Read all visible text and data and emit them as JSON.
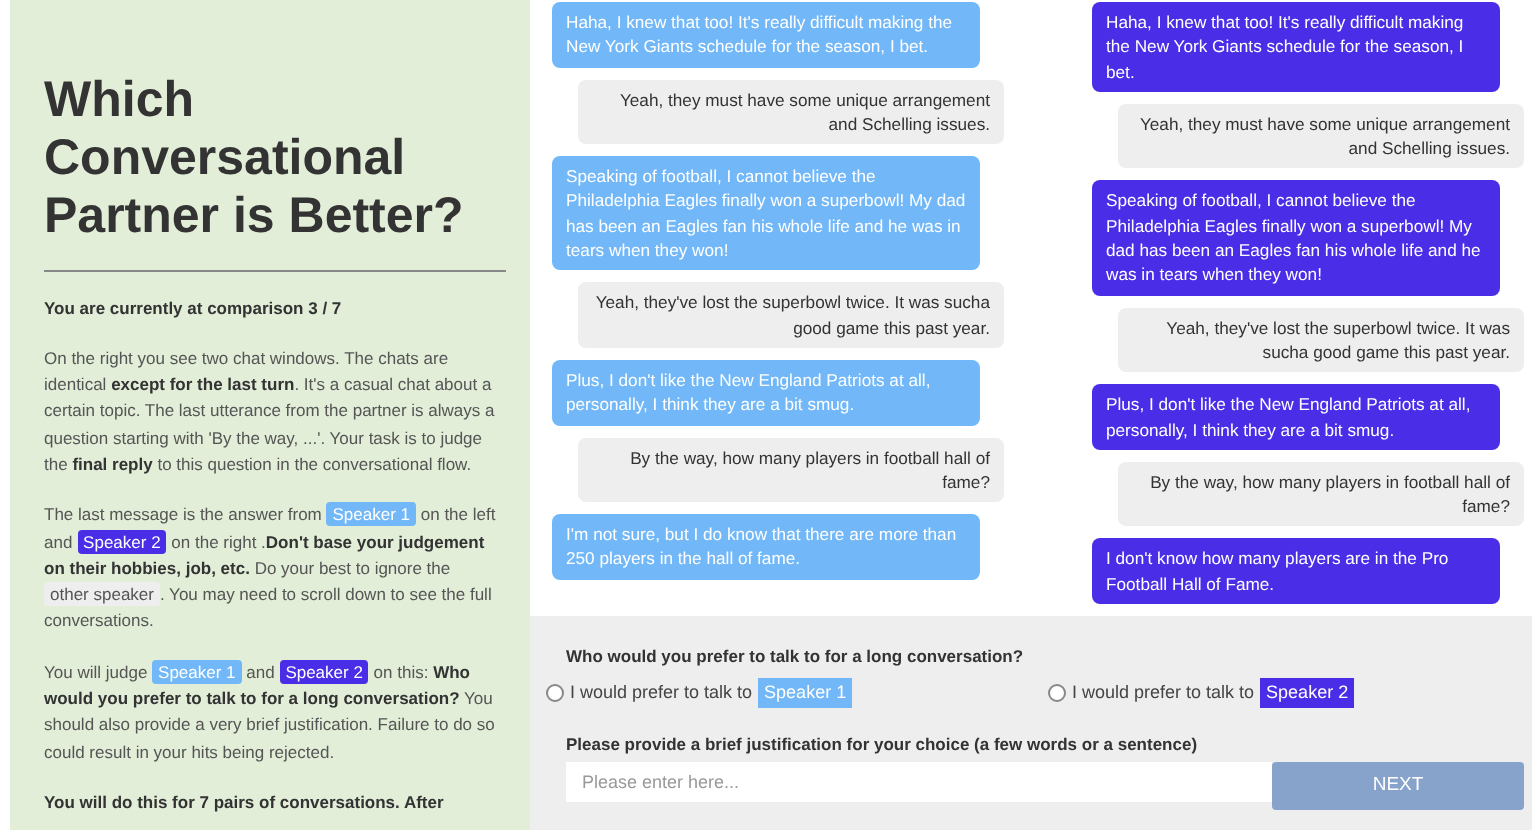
{
  "sidebar": {
    "title": "Which Conversational Partner is Better?",
    "progress": "You are currently at comparison 3 / 7",
    "paragraphs": [
      [
        {
          "kind": "text",
          "text": "On the right you see two chat windows. The chats are identical "
        },
        {
          "kind": "bold",
          "text": "except for the last turn"
        },
        {
          "kind": "text",
          "text": ". It's a casual chat about a certain topic. The last utterance from the partner is always a question starting with 'By the way, ...'. Your task is to judge the "
        },
        {
          "kind": "bold",
          "text": "final reply"
        },
        {
          "kind": "text",
          "text": " to this question in the conversational flow."
        }
      ],
      [
        {
          "kind": "text",
          "text": "The last message is the answer from "
        },
        {
          "kind": "tag",
          "text": "Speaker 1",
          "color": "#72b8f8"
        },
        {
          "kind": "text",
          "text": " on the left and "
        },
        {
          "kind": "tag",
          "text": "Speaker 2",
          "color": "#4a2de6"
        },
        {
          "kind": "text",
          "text": " on the right ."
        },
        {
          "kind": "bold",
          "text": "Don't base your judgement  on their hobbies, job, etc."
        },
        {
          "kind": "text",
          "text": "  Do your best to ignore the "
        },
        {
          "kind": "tag",
          "text": "other speaker",
          "color": "#eeeeee"
        },
        {
          "kind": "text",
          "text": ".  You may need to scroll down to see the full conversations."
        }
      ],
      [
        {
          "kind": "text",
          "text": "You will judge "
        },
        {
          "kind": "tag",
          "text": "Speaker 1",
          "color": "#72b8f8"
        },
        {
          "kind": "text",
          "text": " and "
        },
        {
          "kind": "tag",
          "text": "Speaker 2",
          "color": "#4a2de6"
        },
        {
          "kind": "text",
          "text": " on this: "
        },
        {
          "kind": "bold",
          "text": "Who would you prefer to talk to for a long conversation?"
        },
        {
          "kind": "text",
          "text": " You should  also provide a very brief justification. Failure to do so could result  in your hits being rejected."
        }
      ],
      [
        {
          "kind": "bold",
          "text": "You will do this for 7 pairs of conversations.  After"
        }
      ]
    ]
  },
  "chats": [
    {
      "color": "#72b8f8",
      "messages": [
        {
          "kind": "speaker",
          "text": "Haha, I knew that too! It's really difficult making the New York Giants schedule for the season, I bet."
        },
        {
          "kind": "partner",
          "text": "Yeah, they must have some unique arrangement and Schelling issues."
        },
        {
          "kind": "speaker",
          "text": "Speaking of football, I cannot believe the Philadelphia Eagles finally won a superbowl! My dad has been an Eagles fan his whole life and he was in tears when they won!"
        },
        {
          "kind": "partner",
          "text": "Yeah, they've lost the superbowl twice. It was sucha good game this past year."
        },
        {
          "kind": "speaker",
          "text": "Plus, I don't like the New England Patriots at all, personally, I think they are a bit smug."
        },
        {
          "kind": "partner",
          "text": "By the way, how many players in football hall of fame?"
        },
        {
          "kind": "speaker",
          "text": "I'm not sure, but I do know that there are more than 250 players in the hall of fame."
        }
      ]
    },
    {
      "color": "#4a2de6",
      "messages": [
        {
          "kind": "speaker",
          "text": "Haha, I knew that too! It's really difficult making the New York Giants schedule for the season, I bet."
        },
        {
          "kind": "partner",
          "text": "Yeah, they must have some unique arrangement and Schelling issues."
        },
        {
          "kind": "speaker",
          "text": "Speaking of football, I cannot believe the Philadelphia Eagles finally won a superbowl! My dad has been an Eagles fan his whole life and he was in tears when they won!"
        },
        {
          "kind": "partner",
          "text": "Yeah, they've lost the superbowl twice. It was sucha good game this past year."
        },
        {
          "kind": "speaker",
          "text": "Plus, I don't like the New England Patriots at all, personally, I think they are a bit smug."
        },
        {
          "kind": "partner",
          "text": "By the way, how many players in football hall of fame?"
        },
        {
          "kind": "speaker",
          "text": "I don't know how many players are in the Pro Football Hall of Fame."
        }
      ]
    }
  ],
  "question": "Who would you prefer to talk to for a long conversation?",
  "options": [
    {
      "text": "I would prefer to talk to",
      "tag": "Speaker 1",
      "color": "#72b8f8",
      "selected": false
    },
    {
      "text": "I would prefer to talk to",
      "tag": "Speaker 2",
      "color": "#4a2de6",
      "selected": false
    }
  ],
  "justification": {
    "label": "Please provide a brief justification for your choice (a few words or a sentence)",
    "placeholder": "Please enter here..."
  },
  "next_button": {
    "label": "NEXT",
    "disabled": true
  }
}
